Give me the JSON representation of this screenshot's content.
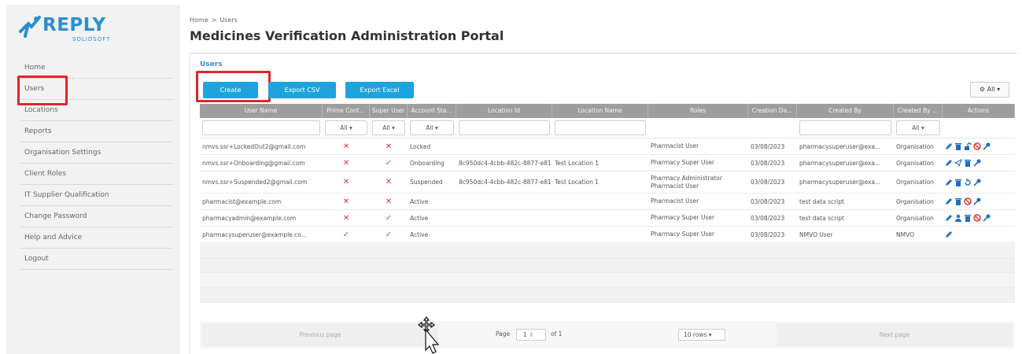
{
  "brand": {
    "name": "REPLY",
    "sub": "SOLIDSOFT",
    "color": "#2a8fd0"
  },
  "sidebar": {
    "items": [
      {
        "label": "Home"
      },
      {
        "label": "Users"
      },
      {
        "label": "Locations"
      },
      {
        "label": "Reports"
      },
      {
        "label": "Organisation Settings"
      },
      {
        "label": "Client Roles"
      },
      {
        "label": "IT Supplier Qualification"
      },
      {
        "label": "Change Password"
      },
      {
        "label": "Help and Advice"
      },
      {
        "label": "Logout"
      }
    ]
  },
  "breadcrumb": {
    "home": "Home",
    "sep": ">",
    "current": "Users"
  },
  "page_title": "Medicines Verification Administration Portal",
  "panel": {
    "title": "Users",
    "create_label": "Create",
    "export_csv_label": "Export CSV",
    "export_excel_label": "Export Excel",
    "columns_button": "All",
    "accent_color": "#1da4dd",
    "highlight_color": "#e0252b"
  },
  "table": {
    "columns": [
      "User Name",
      "Prime Cont...",
      "Super User",
      "Account Sta...",
      "Location Id",
      "Location Name",
      "Roles",
      "Creation Da...",
      "Created By",
      "Created By ...",
      "Actions"
    ],
    "filter_all": "All",
    "rows": [
      {
        "user": "nmvs.ssr+LockedOut2@gmail.com",
        "prime": "x",
        "super": "x",
        "status": "Locked",
        "loc_id": "",
        "loc_name": "",
        "roles": [
          "Pharmacist User"
        ],
        "date": "03/08/2023",
        "created_by": "pharmacysuperuser@exa...",
        "created_by_type": "Organisation",
        "actions": [
          "edit-icon",
          "delete-icon",
          "unlock-icon",
          "block-icon",
          "key-icon"
        ]
      },
      {
        "user": "nmvs.ssr+Onboarding@gmail.com",
        "prime": "x",
        "super": "check",
        "status": "Onboarding",
        "loc_id": "8c950dc4-4cbb-482c-8877-e81",
        "loc_name": "Test Location 1",
        "roles": [
          "Pharmacy Super User"
        ],
        "date": "03/08/2023",
        "created_by": "pharmacysuperuser@exa...",
        "created_by_type": "Organisation",
        "actions": [
          "edit-icon",
          "send-icon",
          "delete-icon",
          "key-icon"
        ]
      },
      {
        "user": "nmvs.ssr+Suspended2@gmail.com",
        "prime": "x",
        "super": "x",
        "status": "Suspended",
        "loc_id": "8c950dc4-4cbb-482c-8877-e81",
        "loc_name": "Test Location 1",
        "roles": [
          "Pharmacy Administrator",
          "Pharmacist User"
        ],
        "date": "03/08/2023",
        "created_by": "pharmacysuperuser@exa...",
        "created_by_type": "Organisation",
        "actions": [
          "edit-icon",
          "delete-icon",
          "restore-icon",
          "key-icon"
        ]
      },
      {
        "user": "pharmacist@example.com",
        "prime": "x",
        "super": "x",
        "status": "Active",
        "loc_id": "",
        "loc_name": "",
        "roles": [
          "Pharmacist User"
        ],
        "date": "03/08/2023",
        "created_by": "test data script",
        "created_by_type": "Organisation",
        "actions": [
          "edit-icon",
          "delete-icon",
          "block-icon",
          "key-icon"
        ]
      },
      {
        "user": "pharmacyadmin@example.com",
        "prime": "x",
        "super": "check",
        "status": "Active",
        "loc_id": "",
        "loc_name": "",
        "roles": [
          "Pharmacy Super User"
        ],
        "date": "03/08/2023",
        "created_by": "test data script",
        "created_by_type": "Organisation",
        "actions": [
          "edit-icon",
          "user-icon",
          "delete-icon",
          "block-icon",
          "key-icon"
        ]
      },
      {
        "user": "pharmacysuperuser@example.co...",
        "prime": "check",
        "super": "check",
        "status": "Active",
        "loc_id": "",
        "loc_name": "",
        "roles": [
          "Pharmacy Super User"
        ],
        "date": "03/08/2023",
        "created_by": "NMVO User",
        "created_by_type": "NMVO",
        "actions": [
          "edit-icon"
        ]
      }
    ]
  },
  "pager": {
    "previous": "Previous page",
    "page_label": "Page",
    "page_value": "1",
    "of_label": "of 1",
    "rows_value": "10 rows",
    "next": "Next page"
  }
}
